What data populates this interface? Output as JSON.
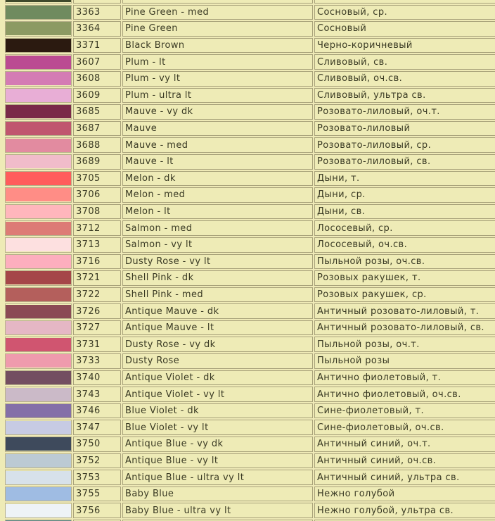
{
  "rows": [
    {
      "code": "",
      "name_en": "",
      "name_ru": "",
      "color": "#3f4a2c"
    },
    {
      "code": "3363",
      "name_en": "Pine Green - med",
      "name_ru": "Сосновый, ср.",
      "color": "#6f8b5f"
    },
    {
      "code": "3364",
      "name_en": "Pine Green",
      "name_ru": "Сосновый",
      "color": "#8c9a63"
    },
    {
      "code": "3371",
      "name_en": "Black Brown",
      "name_ru": "Черно-коричневый",
      "color": "#2b1a10"
    },
    {
      "code": "3607",
      "name_en": "Plum - lt",
      "name_ru": "Сливовый, св.",
      "color": "#bb4b92"
    },
    {
      "code": "3608",
      "name_en": "Plum - vy lt",
      "name_ru": "Сливовый, оч.св.",
      "color": "#d47cb4"
    },
    {
      "code": "3609",
      "name_en": "Plum - ultra lt",
      "name_ru": "Сливовый, ультра св.",
      "color": "#e8aed6"
    },
    {
      "code": "3685",
      "name_en": "Mauve - vy dk",
      "name_ru": "Розовато-лиловый, оч.т.",
      "color": "#7a2a48"
    },
    {
      "code": "3687",
      "name_en": "Mauve",
      "name_ru": "Розовато-лиловый",
      "color": "#c0566f"
    },
    {
      "code": "3688",
      "name_en": "Mauve - med",
      "name_ru": "Розовато-лиловый, ср.",
      "color": "#e28ba0"
    },
    {
      "code": "3689",
      "name_en": "Mauve - lt",
      "name_ru": "Розовато-лиловый, св.",
      "color": "#f1bcca"
    },
    {
      "code": "3705",
      "name_en": "Melon - dk",
      "name_ru": "Дыни, т.",
      "color": "#ff5c5c"
    },
    {
      "code": "3706",
      "name_en": "Melon - med",
      "name_ru": "Дыни, ср.",
      "color": "#ff8d86"
    },
    {
      "code": "3708",
      "name_en": "Melon - lt",
      "name_ru": "Дыни, св.",
      "color": "#ffb6bc"
    },
    {
      "code": "3712",
      "name_en": "Salmon - med",
      "name_ru": "Лососевый, ср.",
      "color": "#dd7b76"
    },
    {
      "code": "3713",
      "name_en": "Salmon - vy lt",
      "name_ru": "Лососевый, оч.св.",
      "color": "#fde0e0"
    },
    {
      "code": "3716",
      "name_en": "Dusty Rose - vy lt",
      "name_ru": "Пыльной розы, оч.св.",
      "color": "#fdaebe"
    },
    {
      "code": "3721",
      "name_en": "Shell Pink - dk",
      "name_ru": "Розовых ракушек, т.",
      "color": "#a54649"
    },
    {
      "code": "3722",
      "name_en": "Shell Pink - med",
      "name_ru": "Розовых ракушек, ср.",
      "color": "#b45f5c"
    },
    {
      "code": "3726",
      "name_en": "Antique Mauve - dk",
      "name_ru": "Античный розовато-лиловый, т.",
      "color": "#8b4a55"
    },
    {
      "code": "3727",
      "name_en": "Antique Mauve - lt",
      "name_ru": "Античный розовато-лиловый, св.",
      "color": "#e5b7c5"
    },
    {
      "code": "3731",
      "name_en": "Dusty Rose - vy dk",
      "name_ru": "Пыльной розы, оч.т.",
      "color": "#d05570"
    },
    {
      "code": "3733",
      "name_en": "Dusty Rose",
      "name_ru": "Пыльной розы",
      "color": "#ef9bad"
    },
    {
      "code": "3740",
      "name_en": "Antique Violet - dk",
      "name_ru": "Антично фиолетовый, т.",
      "color": "#734e61"
    },
    {
      "code": "3743",
      "name_en": "Antique Violet - vy lt",
      "name_ru": "Антично фиолетовый, оч.св.",
      "color": "#cbbac8"
    },
    {
      "code": "3746",
      "name_en": "Blue Violet - dk",
      "name_ru": "Сине-фиолетовый, т.",
      "color": "#8470a8"
    },
    {
      "code": "3747",
      "name_en": "Blue Violet - vy lt",
      "name_ru": "Сине-фиолетовый, оч.св.",
      "color": "#c7cbe3"
    },
    {
      "code": "3750",
      "name_en": "Antique Blue - vy dk",
      "name_ru": "Античный синий, оч.т.",
      "color": "#3e4a5c"
    },
    {
      "code": "3752",
      "name_en": "Antique Blue - vy lt",
      "name_ru": "Античный синий, оч.св.",
      "color": "#bccad4"
    },
    {
      "code": "3753",
      "name_en": "Antique Blue - ultra vy lt",
      "name_ru": "Античный синий, ультра св.",
      "color": "#d7e1ea"
    },
    {
      "code": "3755",
      "name_en": "Baby Blue",
      "name_ru": "Нежно голубой",
      "color": "#9fbce3"
    },
    {
      "code": "3756",
      "name_en": "Baby Blue - ultra vy lt",
      "name_ru": "Нежно голубой, ультра св.",
      "color": "#eef3f6"
    },
    {
      "code": "",
      "name_en": "",
      "name_ru": "",
      "color": "#5d8a8a"
    }
  ]
}
